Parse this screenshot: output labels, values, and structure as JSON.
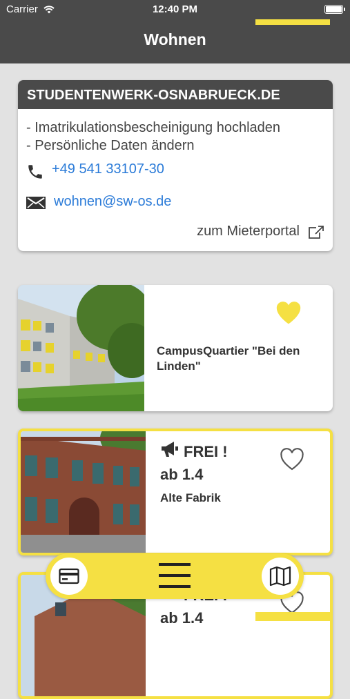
{
  "status": {
    "carrier": "Carrier",
    "time": "12:40 PM"
  },
  "header": {
    "title": "Wohnen"
  },
  "info": {
    "heading": "STUDENTENWERK-OSNABRUECK.DE",
    "lines": [
      "- Imatrikulationsbescheinigung hochladen",
      "- Persönliche Daten ändern"
    ],
    "phone": "+49 541 33107-30",
    "email": "wohnen@sw-os.de",
    "portal": "zum Mieterportal"
  },
  "listings": [
    {
      "name": "CampusQuartier \"Bei den Linden\"",
      "favorite": true
    },
    {
      "status": "FREI !",
      "date": "ab 1.4",
      "name": "Alte Fabrik",
      "favorite": false
    },
    {
      "status": "FREI !",
      "date": "ab 1.4",
      "favorite": false
    }
  ],
  "colors": {
    "accent": "#f5e043",
    "header": "#4a4a4a",
    "link": "#2b7bd8"
  },
  "icons": {
    "phone": "phone-icon",
    "mail": "mail-icon",
    "share": "external-link-icon",
    "card": "credit-card-icon",
    "menu": "menu-icon",
    "map": "map-icon"
  }
}
